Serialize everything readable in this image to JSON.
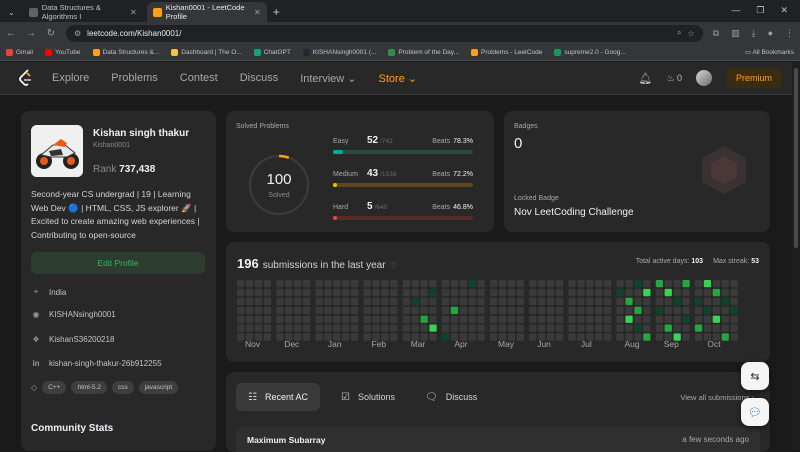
{
  "browser": {
    "tabs": [
      {
        "title": "Data Structures & Algorithms I",
        "active": false
      },
      {
        "title": "Kishan0001 - LeetCode Profile",
        "active": true
      }
    ],
    "url": "leetcode.com/Kishan0001/",
    "bookmarks": [
      {
        "label": "Gmail",
        "color": "#ea4335"
      },
      {
        "label": "YouTube",
        "color": "#ff0000"
      },
      {
        "label": "Data Structures &...",
        "color": "#ffa116"
      },
      {
        "label": "Dashboard | The O...",
        "color": "#f5c542"
      },
      {
        "label": "ChatGPT",
        "color": "#10a37f"
      },
      {
        "label": "KISHANsingh0001 (...",
        "color": "#24292f"
      },
      {
        "label": "Problem of the Day...",
        "color": "#2f8d46"
      },
      {
        "label": "Problems - LeetCode",
        "color": "#ffa116"
      },
      {
        "label": "supreme2.0 - Goog...",
        "color": "#0f9d58"
      }
    ],
    "all_bookmarks": "All Bookmarks"
  },
  "nav": {
    "items": [
      "Explore",
      "Problems",
      "Contest",
      "Discuss"
    ],
    "interview": "Interview",
    "store": "Store",
    "streak": "0",
    "premium": "Premium"
  },
  "profile": {
    "name": "Kishan singh thakur",
    "username": "Kishan0001",
    "rank_label": "Rank",
    "rank": "737,438",
    "bio": "Second-year CS undergrad | 19 | Learning Web Dev 🔵 | HTML, CSS, JS explorer 🚀 | Excited to create amazing web experiences | Contributing to open-source",
    "edit_label": "Edit Profile",
    "location": "India",
    "github": "KISHANsingh0001",
    "twitter": "KishanS36200218",
    "linkedin": "kishan-singh-thakur-26b912255",
    "skills": [
      "C++",
      "html-5.2",
      "css",
      "javascript"
    ],
    "community_title": "Community Stats"
  },
  "solved": {
    "title": "Solved Problems",
    "total": "100",
    "total_label": "Solved",
    "beats_label": "Beats",
    "difficulties": [
      {
        "name": "Easy",
        "count": "52",
        "total": "/742",
        "beats": "78.3%",
        "fraction": 0.07,
        "color": "#00af9b",
        "track": "#2a4a42"
      },
      {
        "name": "Medium",
        "count": "43",
        "total": "/1538",
        "beats": "72.2%",
        "fraction": 0.028,
        "color": "#ffb800",
        "track": "#5a4a1e"
      },
      {
        "name": "Hard",
        "count": "5",
        "total": "/640",
        "beats": "46.8%",
        "fraction": 0.008,
        "color": "#ef4743",
        "track": "#5a2a28"
      }
    ]
  },
  "badges": {
    "title": "Badges",
    "count": "0",
    "locked_label": "Locked Badge",
    "locked_name": "Nov LeetCoding Challenge"
  },
  "submissions": {
    "count": "196",
    "label": "submissions in the last year",
    "active_days_label": "Total active days:",
    "active_days": "103",
    "max_streak_label": "Max streak:",
    "max_streak": "53",
    "months": [
      "Nov",
      "Dec",
      "Jan",
      "Feb",
      "Mar",
      "Apr",
      "May",
      "Jun",
      "Jul",
      "Aug",
      "Sep",
      "Oct"
    ],
    "month_weeks": [
      4,
      4,
      5,
      4,
      4,
      5,
      4,
      4,
      5,
      4,
      4,
      5
    ],
    "activity_by_month": [
      [],
      [],
      [],
      [],
      [
        [
          1,
          2,
          1
        ],
        [
          2,
          4,
          2
        ],
        [
          3,
          1,
          1
        ],
        [
          3,
          5,
          3
        ]
      ],
      [
        [
          0,
          6,
          1
        ],
        [
          1,
          3,
          2
        ],
        [
          3,
          0,
          1
        ]
      ],
      [],
      [],
      [],
      [
        [
          0,
          1,
          1
        ],
        [
          1,
          2,
          2
        ],
        [
          1,
          4,
          3
        ],
        [
          2,
          0,
          1
        ],
        [
          2,
          3,
          2
        ],
        [
          2,
          5,
          1
        ],
        [
          3,
          1,
          3
        ],
        [
          3,
          6,
          2
        ]
      ],
      [
        [
          0,
          0,
          2
        ],
        [
          0,
          3,
          1
        ],
        [
          1,
          1,
          3
        ],
        [
          1,
          5,
          2
        ],
        [
          2,
          2,
          1
        ],
        [
          2,
          6,
          3
        ],
        [
          3,
          0,
          2
        ],
        [
          3,
          4,
          1
        ]
      ],
      [
        [
          0,
          2,
          1
        ],
        [
          0,
          5,
          2
        ],
        [
          1,
          0,
          3
        ],
        [
          1,
          3,
          1
        ],
        [
          2,
          1,
          2
        ],
        [
          2,
          4,
          3
        ],
        [
          3,
          2,
          1
        ],
        [
          3,
          6,
          2
        ],
        [
          4,
          3,
          1
        ]
      ]
    ],
    "colors": [
      "#3a3a3a",
      "#0e4429",
      "#26a641",
      "#39d353"
    ]
  },
  "activity": {
    "tabs": [
      "Recent AC",
      "Solutions",
      "Discuss"
    ],
    "view_all": "View all submissions",
    "recent": {
      "title": "Maximum Subarray",
      "time": "a few seconds ago"
    }
  }
}
